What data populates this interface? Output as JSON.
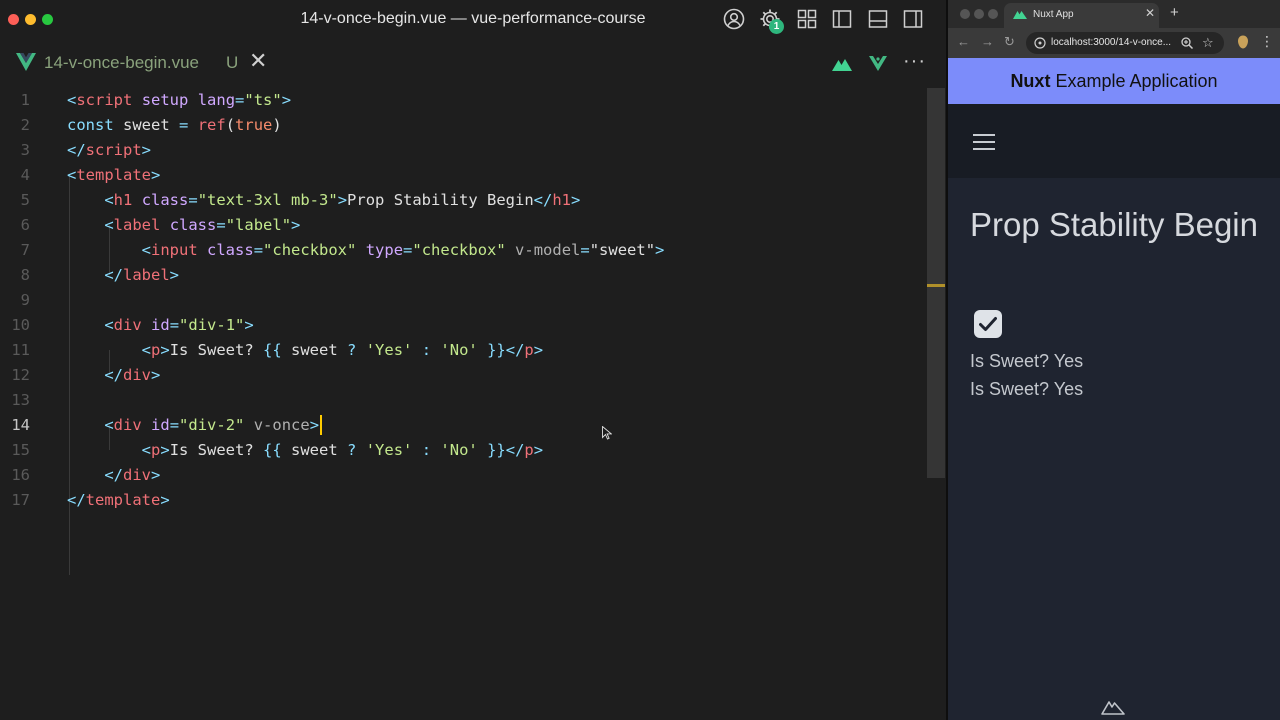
{
  "editor": {
    "window_title": "14-v-once-begin.vue — vue-performance-course",
    "badge_count": "1",
    "tab": {
      "filename": "14-v-once-begin.vue",
      "status": "U",
      "close_glyph": "✕"
    },
    "more_glyph": "···",
    "current_line": 14,
    "lines": [
      {
        "n": "1",
        "tokens": [
          [
            "t-pun",
            "<"
          ],
          [
            "t-tag",
            "script"
          ],
          [
            "t-txt",
            " "
          ],
          [
            "t-attr",
            "setup"
          ],
          [
            "t-txt",
            " "
          ],
          [
            "t-attr",
            "lang"
          ],
          [
            "t-pun",
            "="
          ],
          [
            "t-str",
            "\"ts\""
          ],
          [
            "t-pun",
            ">"
          ]
        ]
      },
      {
        "n": "2",
        "tokens": [
          [
            "t-kw",
            "const"
          ],
          [
            "t-txt",
            " sweet "
          ],
          [
            "t-pun",
            "="
          ],
          [
            "t-txt",
            " "
          ],
          [
            "t-fn",
            "ref"
          ],
          [
            "t-txt",
            "("
          ],
          [
            "t-num",
            "true"
          ],
          [
            "t-txt",
            ")"
          ]
        ]
      },
      {
        "n": "3",
        "tokens": [
          [
            "t-pun",
            "</"
          ],
          [
            "t-tag",
            "script"
          ],
          [
            "t-pun",
            ">"
          ]
        ]
      },
      {
        "n": "4",
        "tokens": [
          [
            "t-pun",
            "<"
          ],
          [
            "t-tag",
            "template"
          ],
          [
            "t-pun",
            ">"
          ]
        ]
      },
      {
        "n": "5",
        "tokens": [
          [
            "t-txt",
            "    "
          ],
          [
            "t-pun",
            "<"
          ],
          [
            "t-tag",
            "h1"
          ],
          [
            "t-txt",
            " "
          ],
          [
            "t-attr",
            "class"
          ],
          [
            "t-pun",
            "="
          ],
          [
            "t-str",
            "\"text-3xl mb-3\""
          ],
          [
            "t-pun",
            ">"
          ],
          [
            "t-txt",
            "Prop Stability Begin"
          ],
          [
            "t-pun",
            "</"
          ],
          [
            "t-tag",
            "h1"
          ],
          [
            "t-pun",
            ">"
          ]
        ]
      },
      {
        "n": "6",
        "tokens": [
          [
            "t-txt",
            "    "
          ],
          [
            "t-pun",
            "<"
          ],
          [
            "t-tag",
            "label"
          ],
          [
            "t-txt",
            " "
          ],
          [
            "t-attr",
            "class"
          ],
          [
            "t-pun",
            "="
          ],
          [
            "t-str",
            "\"label\""
          ],
          [
            "t-pun",
            ">"
          ]
        ]
      },
      {
        "n": "7",
        "tokens": [
          [
            "t-txt",
            "        "
          ],
          [
            "t-pun",
            "<"
          ],
          [
            "t-tag",
            "input"
          ],
          [
            "t-txt",
            " "
          ],
          [
            "t-attr",
            "class"
          ],
          [
            "t-pun",
            "="
          ],
          [
            "t-str",
            "\"checkbox\""
          ],
          [
            "t-txt",
            " "
          ],
          [
            "t-attr",
            "type"
          ],
          [
            "t-pun",
            "="
          ],
          [
            "t-str",
            "\"checkbox\""
          ],
          [
            "t-txt",
            " "
          ],
          [
            "t-dir",
            "v-model"
          ],
          [
            "t-pun",
            "="
          ],
          [
            "t-txt",
            "\"sweet\""
          ],
          [
            "t-pun",
            ">"
          ]
        ]
      },
      {
        "n": "8",
        "tokens": [
          [
            "t-txt",
            "    "
          ],
          [
            "t-pun",
            "</"
          ],
          [
            "t-tag",
            "label"
          ],
          [
            "t-pun",
            ">"
          ]
        ]
      },
      {
        "n": "9",
        "tokens": []
      },
      {
        "n": "10",
        "tokens": [
          [
            "t-txt",
            "    "
          ],
          [
            "t-pun",
            "<"
          ],
          [
            "t-tag",
            "div"
          ],
          [
            "t-txt",
            " "
          ],
          [
            "t-attr",
            "id"
          ],
          [
            "t-pun",
            "="
          ],
          [
            "t-str",
            "\"div-1\""
          ],
          [
            "t-pun",
            ">"
          ]
        ]
      },
      {
        "n": "11",
        "tokens": [
          [
            "t-txt",
            "        "
          ],
          [
            "t-pun",
            "<"
          ],
          [
            "t-tag",
            "p"
          ],
          [
            "t-pun",
            ">"
          ],
          [
            "t-txt",
            "Is Sweet? "
          ],
          [
            "t-pun",
            "{{"
          ],
          [
            "t-txt",
            " sweet "
          ],
          [
            "t-pun",
            "?"
          ],
          [
            "t-txt",
            " "
          ],
          [
            "t-str",
            "'Yes'"
          ],
          [
            "t-txt",
            " "
          ],
          [
            "t-pun",
            ":"
          ],
          [
            "t-txt",
            " "
          ],
          [
            "t-str",
            "'No'"
          ],
          [
            "t-txt",
            " "
          ],
          [
            "t-pun",
            "}}"
          ],
          [
            "t-pun",
            "</"
          ],
          [
            "t-tag",
            "p"
          ],
          [
            "t-pun",
            ">"
          ]
        ]
      },
      {
        "n": "12",
        "tokens": [
          [
            "t-txt",
            "    "
          ],
          [
            "t-pun",
            "</"
          ],
          [
            "t-tag",
            "div"
          ],
          [
            "t-pun",
            ">"
          ]
        ]
      },
      {
        "n": "13",
        "tokens": []
      },
      {
        "n": "14",
        "tokens": [
          [
            "t-txt",
            "    "
          ],
          [
            "t-pun",
            "<"
          ],
          [
            "t-tag",
            "div"
          ],
          [
            "t-txt",
            " "
          ],
          [
            "t-attr",
            "id"
          ],
          [
            "t-pun",
            "="
          ],
          [
            "t-str",
            "\"div-2\""
          ],
          [
            "t-txt",
            " "
          ],
          [
            "t-dir",
            "v-once"
          ],
          [
            "t-pun",
            ">"
          ]
        ]
      },
      {
        "n": "15",
        "tokens": [
          [
            "t-txt",
            "        "
          ],
          [
            "t-pun",
            "<"
          ],
          [
            "t-tag",
            "p"
          ],
          [
            "t-pun",
            ">"
          ],
          [
            "t-txt",
            "Is Sweet? "
          ],
          [
            "t-pun",
            "{{"
          ],
          [
            "t-txt",
            " sweet "
          ],
          [
            "t-pun",
            "?"
          ],
          [
            "t-txt",
            " "
          ],
          [
            "t-str",
            "'Yes'"
          ],
          [
            "t-txt",
            " "
          ],
          [
            "t-pun",
            ":"
          ],
          [
            "t-txt",
            " "
          ],
          [
            "t-str",
            "'No'"
          ],
          [
            "t-txt",
            " "
          ],
          [
            "t-pun",
            "}}"
          ],
          [
            "t-pun",
            "</"
          ],
          [
            "t-tag",
            "p"
          ],
          [
            "t-pun",
            ">"
          ]
        ]
      },
      {
        "n": "16",
        "tokens": [
          [
            "t-txt",
            "    "
          ],
          [
            "t-pun",
            "</"
          ],
          [
            "t-tag",
            "div"
          ],
          [
            "t-pun",
            ">"
          ]
        ]
      },
      {
        "n": "17",
        "tokens": [
          [
            "t-pun",
            "</"
          ],
          [
            "t-tag",
            "template"
          ],
          [
            "t-pun",
            ">"
          ]
        ]
      }
    ]
  },
  "browser": {
    "tab_title": "Nuxt App",
    "tab_close_glyph": "✕",
    "new_tab_glyph": "+",
    "url": "localhost:3000/14-v-once...",
    "header": {
      "brand": "Nuxt",
      "rest": " Example Application"
    },
    "page": {
      "heading": "Prop Stability Begin",
      "checkbox_checked": true,
      "lines": [
        "Is Sweet? Yes",
        "Is Sweet? Yes"
      ]
    }
  },
  "colors": {
    "editor_bg": "#1e1e1e",
    "nuxt_header": "#7c8cfa",
    "cursor": "#ffcc00",
    "vue_green": "#42b883"
  }
}
